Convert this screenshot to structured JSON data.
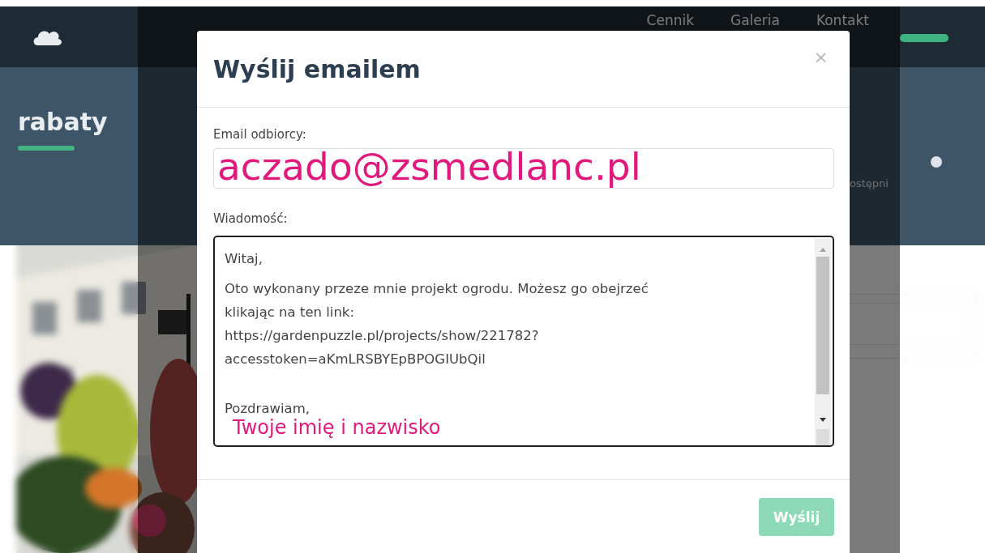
{
  "header": {
    "nav": [
      {
        "label": "Cennik"
      },
      {
        "label": "Galeria"
      },
      {
        "label": "Kontakt"
      }
    ]
  },
  "hero": {
    "title": "rabaty",
    "share_label": "ostępni"
  },
  "modal": {
    "title": "Wyślij emailem",
    "close": "×",
    "email_label": "Email odbiorcy:",
    "email_value": "aczado@zsmedlanc.pl",
    "message_label": "Wiadomość:",
    "message_paragraphs": [
      [
        "Witaj,"
      ],
      [
        "Oto wykonany przeze mnie projekt ogrodu. Możesz go obejrzeć",
        "klikając na ten link:",
        "https://gardenpuzzle.pl/projects/show/221782?",
        "accesstoken=aKmLRSBYEpBPOGIUbQil"
      ],
      [
        "Pozdrawiam,"
      ]
    ],
    "signature": "Twoje imię i nazwisko",
    "send_button": {
      "label": "Wyślij",
      "disabled": true
    }
  }
}
